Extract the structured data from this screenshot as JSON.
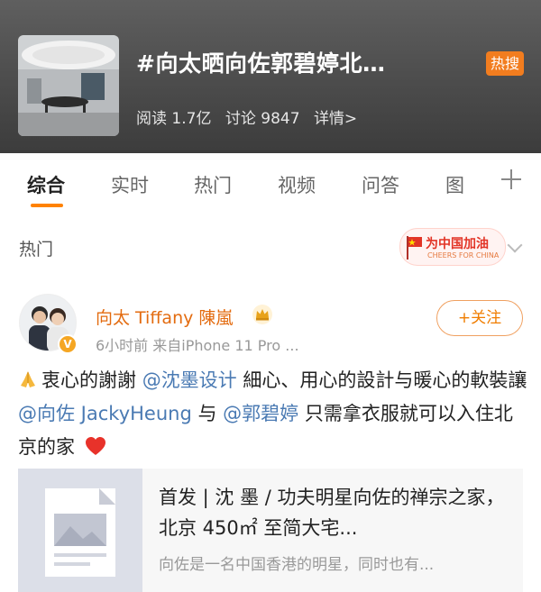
{
  "topic": {
    "title": "#向太晒向佐郭碧婷北…",
    "badge": "热搜",
    "reads": "阅读 1.7亿",
    "discussions": "讨论 9847",
    "details": "详情>"
  },
  "tabs": [
    {
      "label": "综合",
      "active": true
    },
    {
      "label": "实时"
    },
    {
      "label": "热门"
    },
    {
      "label": "视频"
    },
    {
      "label": "问答"
    },
    {
      "label": "图"
    }
  ],
  "section": {
    "label": "热门",
    "cheer_title": "为中国加油",
    "cheer_sub": "CHEERS FOR CHINA"
  },
  "post": {
    "author": "向太 Tiffany 陳嵐",
    "meta": "6小时前  来自iPhone 11 Pro ...",
    "follow_label": "+关注",
    "text_1": "衷心的謝謝",
    "mention_1": "@沈墨设计",
    "text_2": "細心、用心的設計与暖心的軟裝讓",
    "mention_2": "@向佐 JackyHeung",
    "text_3": "与",
    "mention_3": "@郭碧婷",
    "text_4": "只需拿衣服就可以入住北京的家"
  },
  "card": {
    "title": "首发 | 沈 墨 / 功夫明星向佐的禅宗之家，北京 450㎡ 至简大宅...",
    "description": "向佐是一名中国香港的明星，同时也有..."
  },
  "colors": {
    "accent": "#ff8200",
    "hot_badge": "#f27d1f",
    "mention": "#4a7ab3",
    "author": "#e36b0f"
  }
}
